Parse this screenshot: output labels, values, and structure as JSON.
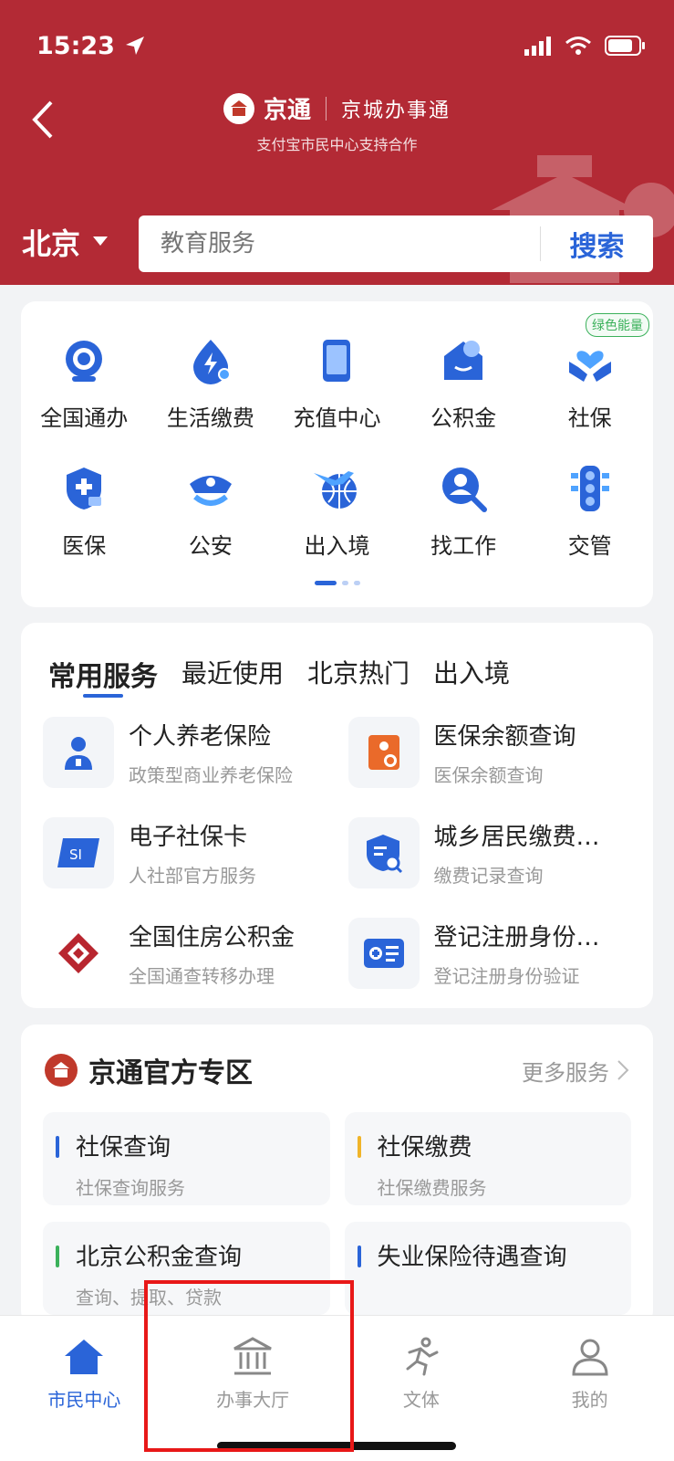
{
  "status_bar": {
    "time": "15:23"
  },
  "header": {
    "brand_name": "京通",
    "brand_slogan": "京城办事通",
    "subtitle": "支付宝市民中心支持合作",
    "logo_text": "京通",
    "city": "北京",
    "search_placeholder": "教育服务",
    "search_button": "搜索"
  },
  "grid": {
    "energy_badge": "绿色能量",
    "items": [
      {
        "label": "全国通办",
        "icon": "globe-service-icon"
      },
      {
        "label": "生活缴费",
        "icon": "utility-payment-icon"
      },
      {
        "label": "充值中心",
        "icon": "phone-recharge-icon"
      },
      {
        "label": "公积金",
        "icon": "housing-fund-icon"
      },
      {
        "label": "社保",
        "icon": "social-security-icon"
      },
      {
        "label": "医保",
        "icon": "medical-insurance-icon"
      },
      {
        "label": "公安",
        "icon": "police-cap-icon"
      },
      {
        "label": "出入境",
        "icon": "airplane-globe-icon"
      },
      {
        "label": "找工作",
        "icon": "job-search-icon"
      },
      {
        "label": "交管",
        "icon": "traffic-light-icon"
      }
    ]
  },
  "services": {
    "tabs": [
      "常用服务",
      "最近使用",
      "北京热门",
      "出入境"
    ],
    "items": [
      {
        "title": "个人养老保险",
        "subtitle": "政策型商业养老保险",
        "icon": "pension-person-icon"
      },
      {
        "title": "医保余额查询",
        "subtitle": "医保余额查询",
        "icon": "medical-balance-icon"
      },
      {
        "title": "电子社保卡",
        "subtitle": "人社部官方服务",
        "icon": "social-card-icon"
      },
      {
        "title": "城乡居民缴费…",
        "subtitle": "缴费记录查询",
        "icon": "payment-record-icon"
      },
      {
        "title": "全国住房公积金",
        "subtitle": "全国通查转移办理",
        "icon": "housing-fund-logo-icon"
      },
      {
        "title": "登记注册身份…",
        "subtitle": "登记注册身份验证",
        "icon": "id-card-icon"
      }
    ]
  },
  "zone": {
    "title": "京通官方专区",
    "more": "更多服务",
    "logo_text": "京通",
    "items": [
      {
        "title": "社保查询",
        "subtitle": "社保查询服务",
        "color": "#2a64d8"
      },
      {
        "title": "社保缴费",
        "subtitle": "社保缴费服务",
        "color": "#f0b429"
      },
      {
        "title": "北京公积金查询",
        "subtitle": "查询、提取、贷款",
        "color": "#3bb15b"
      },
      {
        "title": "失业保险待遇查询",
        "subtitle": "",
        "color": "#2a64d8"
      }
    ]
  },
  "tabbar": {
    "items": [
      {
        "label": "市民中心",
        "active": true
      },
      {
        "label": "办事大厅",
        "active": false
      },
      {
        "label": "文体",
        "active": false
      },
      {
        "label": "我的",
        "active": false
      }
    ]
  },
  "colors": {
    "brand_red": "#b32a35",
    "accent_blue": "#2a64d8",
    "highlight_red": "#e81818"
  }
}
